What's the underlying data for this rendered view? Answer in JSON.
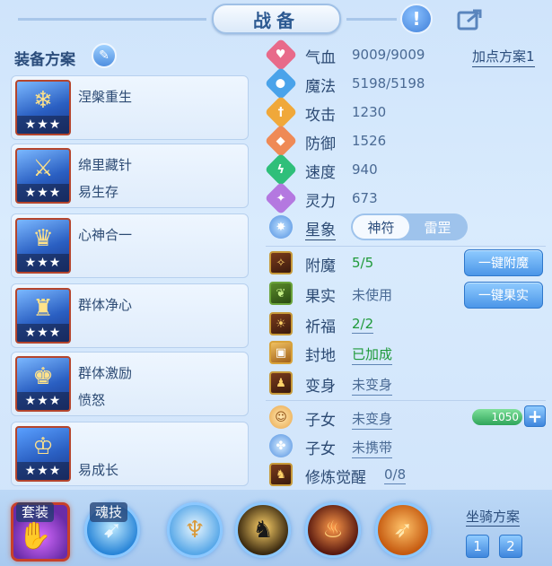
{
  "header": {
    "title": "战备"
  },
  "equipment_plans": {
    "title": "装备方案",
    "cards": [
      {
        "line1": "涅槃重生",
        "line2": "",
        "stars": "★★★"
      },
      {
        "line1": "绵里藏针",
        "line2": "易生存",
        "stars": "★★★"
      },
      {
        "line1": "心神合一",
        "line2": "",
        "stars": "★★★"
      },
      {
        "line1": "群体净心",
        "line2": "",
        "stars": "★★★"
      },
      {
        "line1": "群体激励",
        "line2": "愤怒",
        "stars": "★★★"
      },
      {
        "line1": "",
        "line2": "易成长",
        "stars": "★★★"
      }
    ]
  },
  "stats": {
    "plan_link": "加点方案1",
    "items": [
      {
        "label": "气血",
        "value": "9009/9009",
        "color": "#e86a8a"
      },
      {
        "label": "魔法",
        "value": "5198/5198",
        "color": "#4aa3ea"
      },
      {
        "label": "攻击",
        "value": "1230",
        "color": "#f0a83a"
      },
      {
        "label": "防御",
        "value": "1526",
        "color": "#ef8a56"
      },
      {
        "label": "速度",
        "value": "940",
        "color": "#2fbf7a"
      },
      {
        "label": "灵力",
        "value": "673",
        "color": "#b478e0"
      }
    ],
    "star_label": "星象",
    "toggle": [
      "神符",
      "雷罡"
    ]
  },
  "enhancements": {
    "items": [
      {
        "label": "附魔",
        "value": "5/5",
        "style": "green"
      },
      {
        "label": "果实",
        "value": "未使用",
        "style": "gray"
      },
      {
        "label": "祈福",
        "value": "2/2",
        "style": "green under"
      },
      {
        "label": "封地",
        "value": "已加成",
        "style": "green under"
      },
      {
        "label": "变身",
        "value": "未变身",
        "style": "gray under"
      },
      {
        "label": "子女",
        "value": "未变身",
        "style": "gray under"
      },
      {
        "label": "子女",
        "value": "未携带",
        "style": "gray under"
      },
      {
        "label": "修炼觉醒",
        "value": "0/8",
        "style": "gray under"
      }
    ],
    "btn_enchant": "一键附魔",
    "btn_fruit": "一键果实",
    "child_points": "1050",
    "plus": "+"
  },
  "bottom": {
    "suit_label": "套装",
    "soul_label": "魂技",
    "mount_title": "坐骑方案",
    "mount_buttons": [
      "1",
      "2"
    ]
  }
}
